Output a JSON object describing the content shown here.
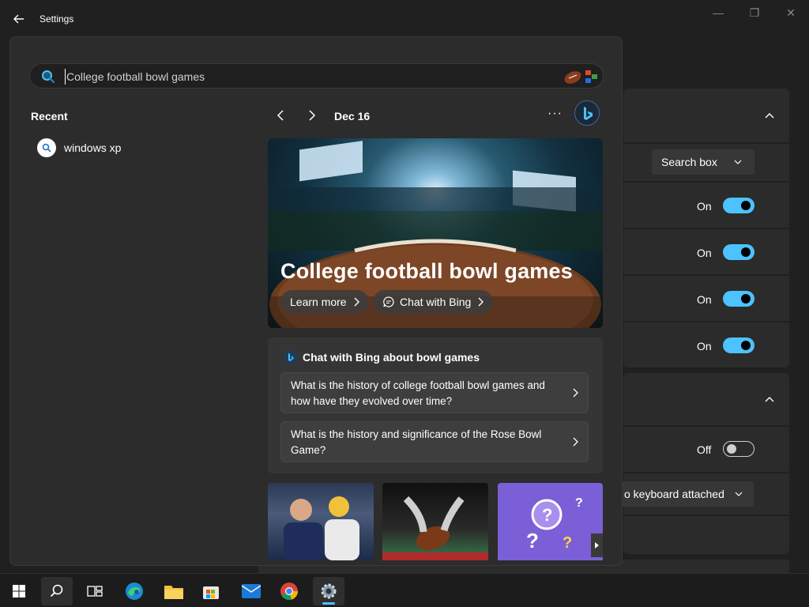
{
  "window": {
    "title": "Settings"
  },
  "settings": {
    "dropdown_search": "Search box",
    "toggles": [
      {
        "state": "On"
      },
      {
        "state": "On"
      },
      {
        "state": "On"
      },
      {
        "state": "On"
      }
    ],
    "toggle_off_label": "Off",
    "dropdown_keyboard": "o keyboard attached"
  },
  "search": {
    "query": "College football bowl games",
    "recent_title": "Recent",
    "recent_items": [
      {
        "label": "windows xp"
      }
    ]
  },
  "bing": {
    "date": "Dec 16",
    "more_label": "···",
    "hero_title": "College football bowl games",
    "learn_more": "Learn more",
    "chat_with_bing": "Chat with Bing",
    "chat_header": "Chat with Bing about bowl games",
    "suggestions": [
      {
        "text": "What is the history of college football bowl games and how have they evolved over time?"
      },
      {
        "text": "What is the history and significance of the Rose Bowl Game?"
      }
    ]
  },
  "taskbar": {
    "items": [
      {
        "name": "start-button"
      },
      {
        "name": "search-button"
      },
      {
        "name": "task-view-button"
      },
      {
        "name": "edge-button"
      },
      {
        "name": "file-explorer-button"
      },
      {
        "name": "store-button"
      },
      {
        "name": "mail-button"
      },
      {
        "name": "chrome-button"
      },
      {
        "name": "settings-button"
      }
    ]
  },
  "colors": {
    "accent": "#4cc2ff",
    "flyout_bg": "#2c2c2c",
    "window_bg": "#202020"
  }
}
